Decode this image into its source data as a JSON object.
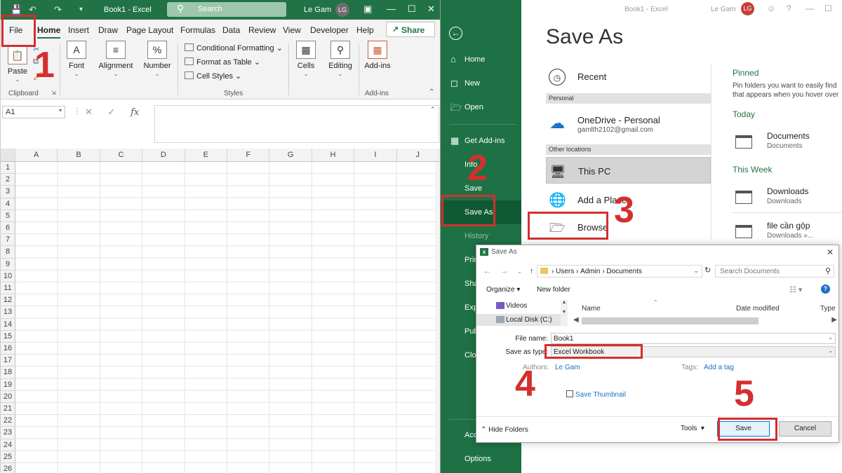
{
  "excel": {
    "doc_title": "Book1  -  Excel",
    "search_placeholder": "Search",
    "user_name": "Le Gam",
    "user_initials": "LG",
    "tabs": [
      "File",
      "Home",
      "Insert",
      "Draw",
      "Page Layout",
      "Formulas",
      "Data",
      "Review",
      "View",
      "Developer",
      "Help"
    ],
    "share_label": "Share",
    "ribbon": {
      "paste": "Paste",
      "font": "Font",
      "alignment": "Alignment",
      "number": "Number",
      "conditional_formatting": "Conditional Formatting",
      "format_as_table": "Format as Table",
      "cell_styles": "Cell Styles",
      "cells": "Cells",
      "editing": "Editing",
      "addins": "Add-ins",
      "groups": {
        "clipboard": "Clipboard",
        "styles": "Styles",
        "addins": "Add-ins"
      }
    },
    "name_box": "A1",
    "fx": "fx",
    "columns": [
      "A",
      "B",
      "C",
      "D",
      "E",
      "F",
      "G",
      "H",
      "I",
      "J"
    ],
    "rows": [
      "1",
      "2",
      "3",
      "4",
      "5",
      "6",
      "7",
      "8",
      "9",
      "10",
      "11",
      "12",
      "13",
      "14",
      "15",
      "16",
      "17",
      "18",
      "19",
      "20",
      "21",
      "22",
      "23",
      "24",
      "25",
      "26"
    ]
  },
  "backstage": {
    "window_title": "Book1  -  Excel",
    "user_name": "Le Gam",
    "user_initials": "LG",
    "nav": {
      "home": "Home",
      "new": "New",
      "open": "Open",
      "get_addins": "Get Add-ins",
      "info": "Info",
      "save": "Save",
      "save_as": "Save As",
      "history": "History",
      "print": "Print",
      "share": "Share",
      "export": "Export",
      "publish": "Publish",
      "close": "Close",
      "account": "Account",
      "options": "Options"
    },
    "title": "Save As",
    "recent": "Recent",
    "personal_section": "Personal",
    "onedrive": "OneDrive - Personal",
    "onedrive_email": "gamlth2102@gmail.com",
    "other_section": "Other locations",
    "this_pc": "This PC",
    "add_place": "Add a Place",
    "browse": "Browse",
    "pinned_title": "Pinned",
    "pinned_text_1": "Pin folders you want to easily find",
    "pinned_text_2": "that appears when you hover over",
    "today": "Today",
    "this_week": "This Week",
    "folders": [
      {
        "name": "Documents",
        "path": "Documents"
      },
      {
        "name": "Downloads",
        "path": "Downloads"
      },
      {
        "name": "file cần gộp",
        "path": "Downloads »..."
      }
    ]
  },
  "dialog": {
    "title": "Save As",
    "breadcrumb": [
      "Users",
      "Admin",
      "Documents"
    ],
    "search_placeholder": "Search Documents",
    "organize": "Organize",
    "new_folder": "New folder",
    "tree": [
      "Videos",
      "Local Disk (C:)"
    ],
    "columns": [
      "Name",
      "Date modified",
      "Type"
    ],
    "file_name_label": "File name:",
    "file_name_value": "Book1",
    "save_type_label": "Save as type:",
    "save_type_value": "Excel Workbook",
    "authors_label": "Authors:",
    "authors_value": "Le Gam",
    "tags_label": "Tags:",
    "tags_value": "Add a tag",
    "save_thumbnail": "Save Thumbnail",
    "hide_folders": "Hide Folders",
    "tools": "Tools",
    "save": "Save",
    "cancel": "Cancel"
  },
  "steps": [
    "1",
    "2",
    "3",
    "4",
    "5"
  ],
  "colors": {
    "excel_green": "#217346",
    "backstage_green": "#1e7145",
    "annotation_red": "#d32f2f",
    "link_blue": "#1a6fc4"
  }
}
